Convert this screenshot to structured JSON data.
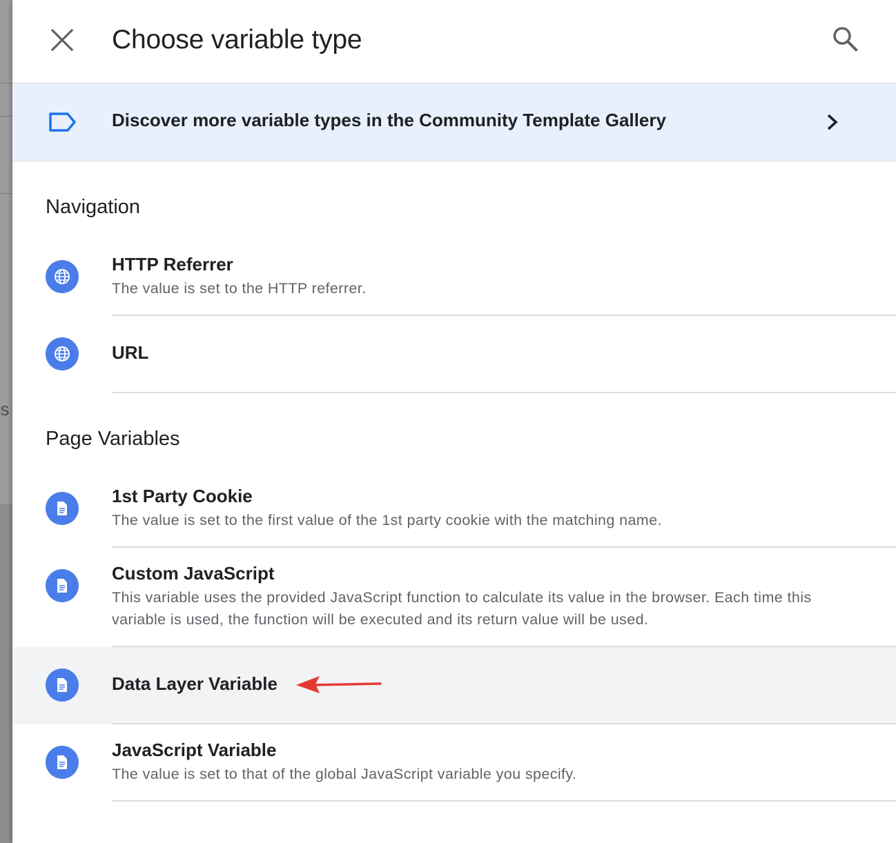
{
  "dialog": {
    "title": "Choose variable type"
  },
  "icons": {
    "close": "close-icon",
    "search": "search-icon",
    "tag": "tag-icon",
    "chevron": "chevron-right-icon",
    "globe": "globe-icon",
    "document": "document-icon",
    "annotation_arrow": "red-arrow"
  },
  "colors": {
    "banner_bg": "#e8f0fe",
    "icon_blue": "#4a7de9",
    "highlight_row": "#f1f3f4",
    "arrow": "#e53935"
  },
  "banner": {
    "text": "Discover more variable types in the Community Template Gallery"
  },
  "sections": [
    {
      "heading": "Navigation",
      "items": [
        {
          "title": "HTTP Referrer",
          "description": "The value is set to the HTTP referrer."
        },
        {
          "title": "URL",
          "description": ""
        }
      ]
    },
    {
      "heading": "Page Variables",
      "items": [
        {
          "title": "1st Party Cookie",
          "description": "The value is set to the first value of the 1st party cookie with the matching name."
        },
        {
          "title": "Custom JavaScript",
          "description": "This variable uses the provided JavaScript function to calculate its value in the browser. Each time this variable is used, the function will be executed and its return value will be used."
        },
        {
          "title": "Data Layer Variable",
          "description": ""
        },
        {
          "title": "JavaScript Variable",
          "description": "The value is set to that of the global JavaScript variable you specify."
        }
      ]
    }
  ],
  "background": {
    "partial_text": "os"
  }
}
